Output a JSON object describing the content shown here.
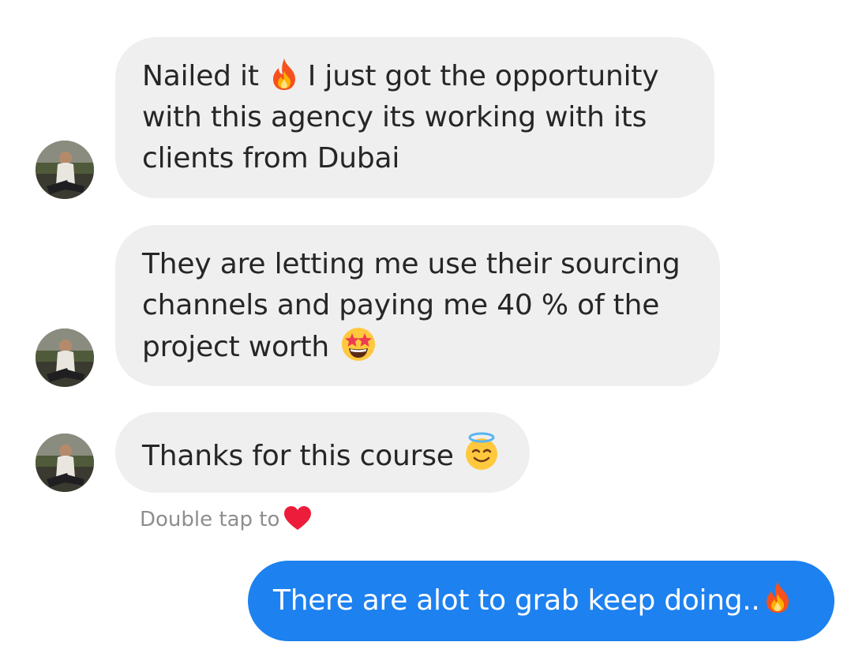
{
  "thread": {
    "incoming": [
      {
        "lines": [
          "Nailed it",
          "I just got the opportunity",
          "with this agency its working with its",
          "clients from Dubai"
        ],
        "emoji": "fire-emoji"
      },
      {
        "lines": [
          "They are letting me use their sourcing",
          "channels and paying me 40 % of the",
          "project worth"
        ],
        "emoji": "star-struck-emoji"
      },
      {
        "lines": [
          "Thanks for this course"
        ],
        "emoji": "smiling-face-with-halo-emoji"
      }
    ],
    "hint": {
      "text": "Double tap to",
      "icon": "heart-icon"
    },
    "outgoing": {
      "text": "There are alot to grab keep doing..",
      "emoji": "fire-emoji"
    }
  },
  "colors": {
    "incoming_bubble": "#efefef",
    "outgoing_bubble": "#1e81f0",
    "text": "#262626",
    "hint_text": "#8e8e8e",
    "heart": "#ed1c3a"
  }
}
